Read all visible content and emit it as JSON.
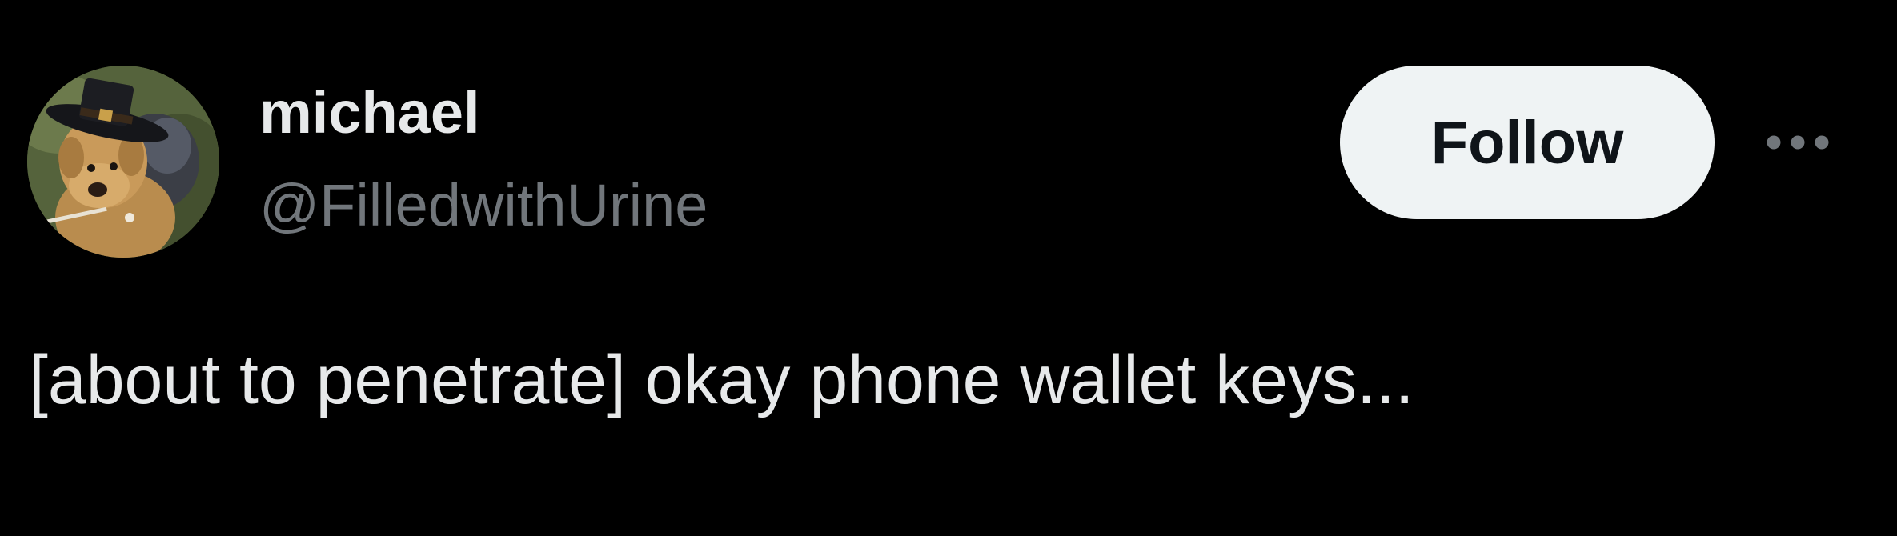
{
  "user": {
    "display_name": "michael",
    "handle": "@FilledwithUrine",
    "avatar": "avatar-plush-dog-in-hat"
  },
  "actions": {
    "follow_label": "Follow",
    "more_icon": "more-horizontal-icon"
  },
  "tweet": {
    "text": "[about to penetrate] okay phone wallet keys..."
  },
  "colors": {
    "background": "#000000",
    "primary_text": "#e7e9ea",
    "secondary_text": "#71767b",
    "follow_bg": "#eff3f4",
    "follow_text": "#0f1419"
  }
}
